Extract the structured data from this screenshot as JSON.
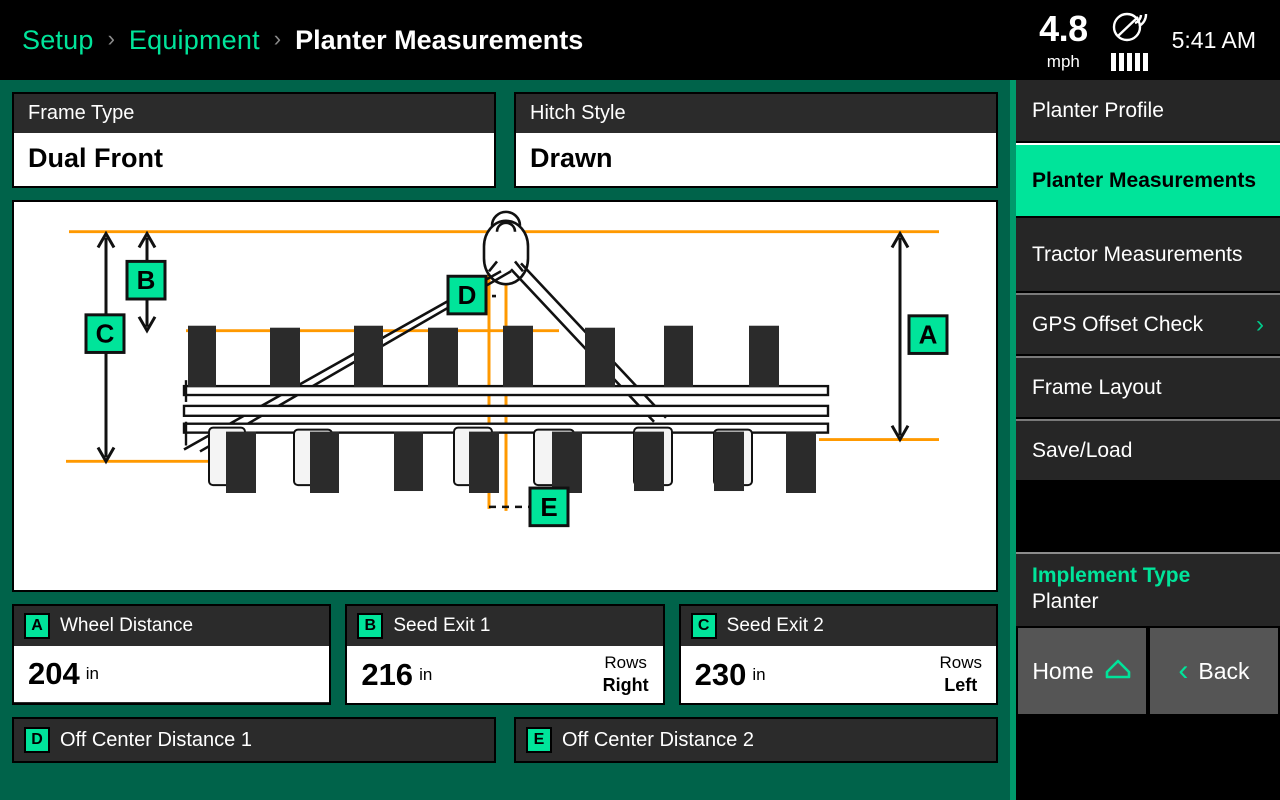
{
  "header": {
    "breadcrumb": [
      {
        "label": "Setup",
        "type": "link"
      },
      {
        "label": "Equipment",
        "type": "link"
      },
      {
        "label": "Planter Measurements",
        "type": "current"
      }
    ],
    "separator": "›",
    "speed_value": "4.8",
    "speed_unit": "mph",
    "gps_icon": "satellite-dish-icon",
    "signal_bars": 5,
    "time": "5:41 AM"
  },
  "settings": {
    "frame_type": {
      "label": "Frame Type",
      "value": "Dual Front"
    },
    "hitch_style": {
      "label": "Hitch Style",
      "value": "Drawn"
    }
  },
  "diagram": {
    "name": "planter-measurement-diagram",
    "badges": [
      "A",
      "B",
      "C",
      "D",
      "E"
    ],
    "accent_line_color": "#ff9900",
    "frame_color": "#2b2b2b"
  },
  "measurements": [
    {
      "badge": "A",
      "label": "Wheel Distance",
      "value": "204",
      "unit": "in",
      "rows_label": "",
      "rows_side": ""
    },
    {
      "badge": "B",
      "label": "Seed Exit 1",
      "value": "216",
      "unit": "in",
      "rows_label": "Rows",
      "rows_side": "Right"
    },
    {
      "badge": "C",
      "label": "Seed Exit 2",
      "value": "230",
      "unit": "in",
      "rows_label": "Rows",
      "rows_side": "Left"
    }
  ],
  "measurements_secondary": [
    {
      "badge": "D",
      "label": "Off Center Distance 1"
    },
    {
      "badge": "E",
      "label": "Off Center Distance 2"
    }
  ],
  "sidebar": {
    "items": [
      {
        "label": "Planter Profile",
        "active": false,
        "chevron": false
      },
      {
        "label": "Planter Measurements",
        "active": true,
        "chevron": false
      },
      {
        "label": "Tractor Measurements",
        "active": false,
        "chevron": false
      },
      {
        "label": "GPS Offset Check",
        "active": false,
        "chevron": true
      },
      {
        "label": "Frame Layout",
        "active": false,
        "chevron": false
      },
      {
        "label": "Save/Load",
        "active": false,
        "chevron": false
      }
    ],
    "chevron_glyph": "›",
    "implement": {
      "title": "Implement Type",
      "value": "Planter"
    },
    "home_label": "Home",
    "back_label": "Back",
    "back_glyph": "‹"
  },
  "colors": {
    "background": "#00634a",
    "accent_green": "#00e49a",
    "panel_dark": "#262626",
    "orange": "#ff9900"
  }
}
